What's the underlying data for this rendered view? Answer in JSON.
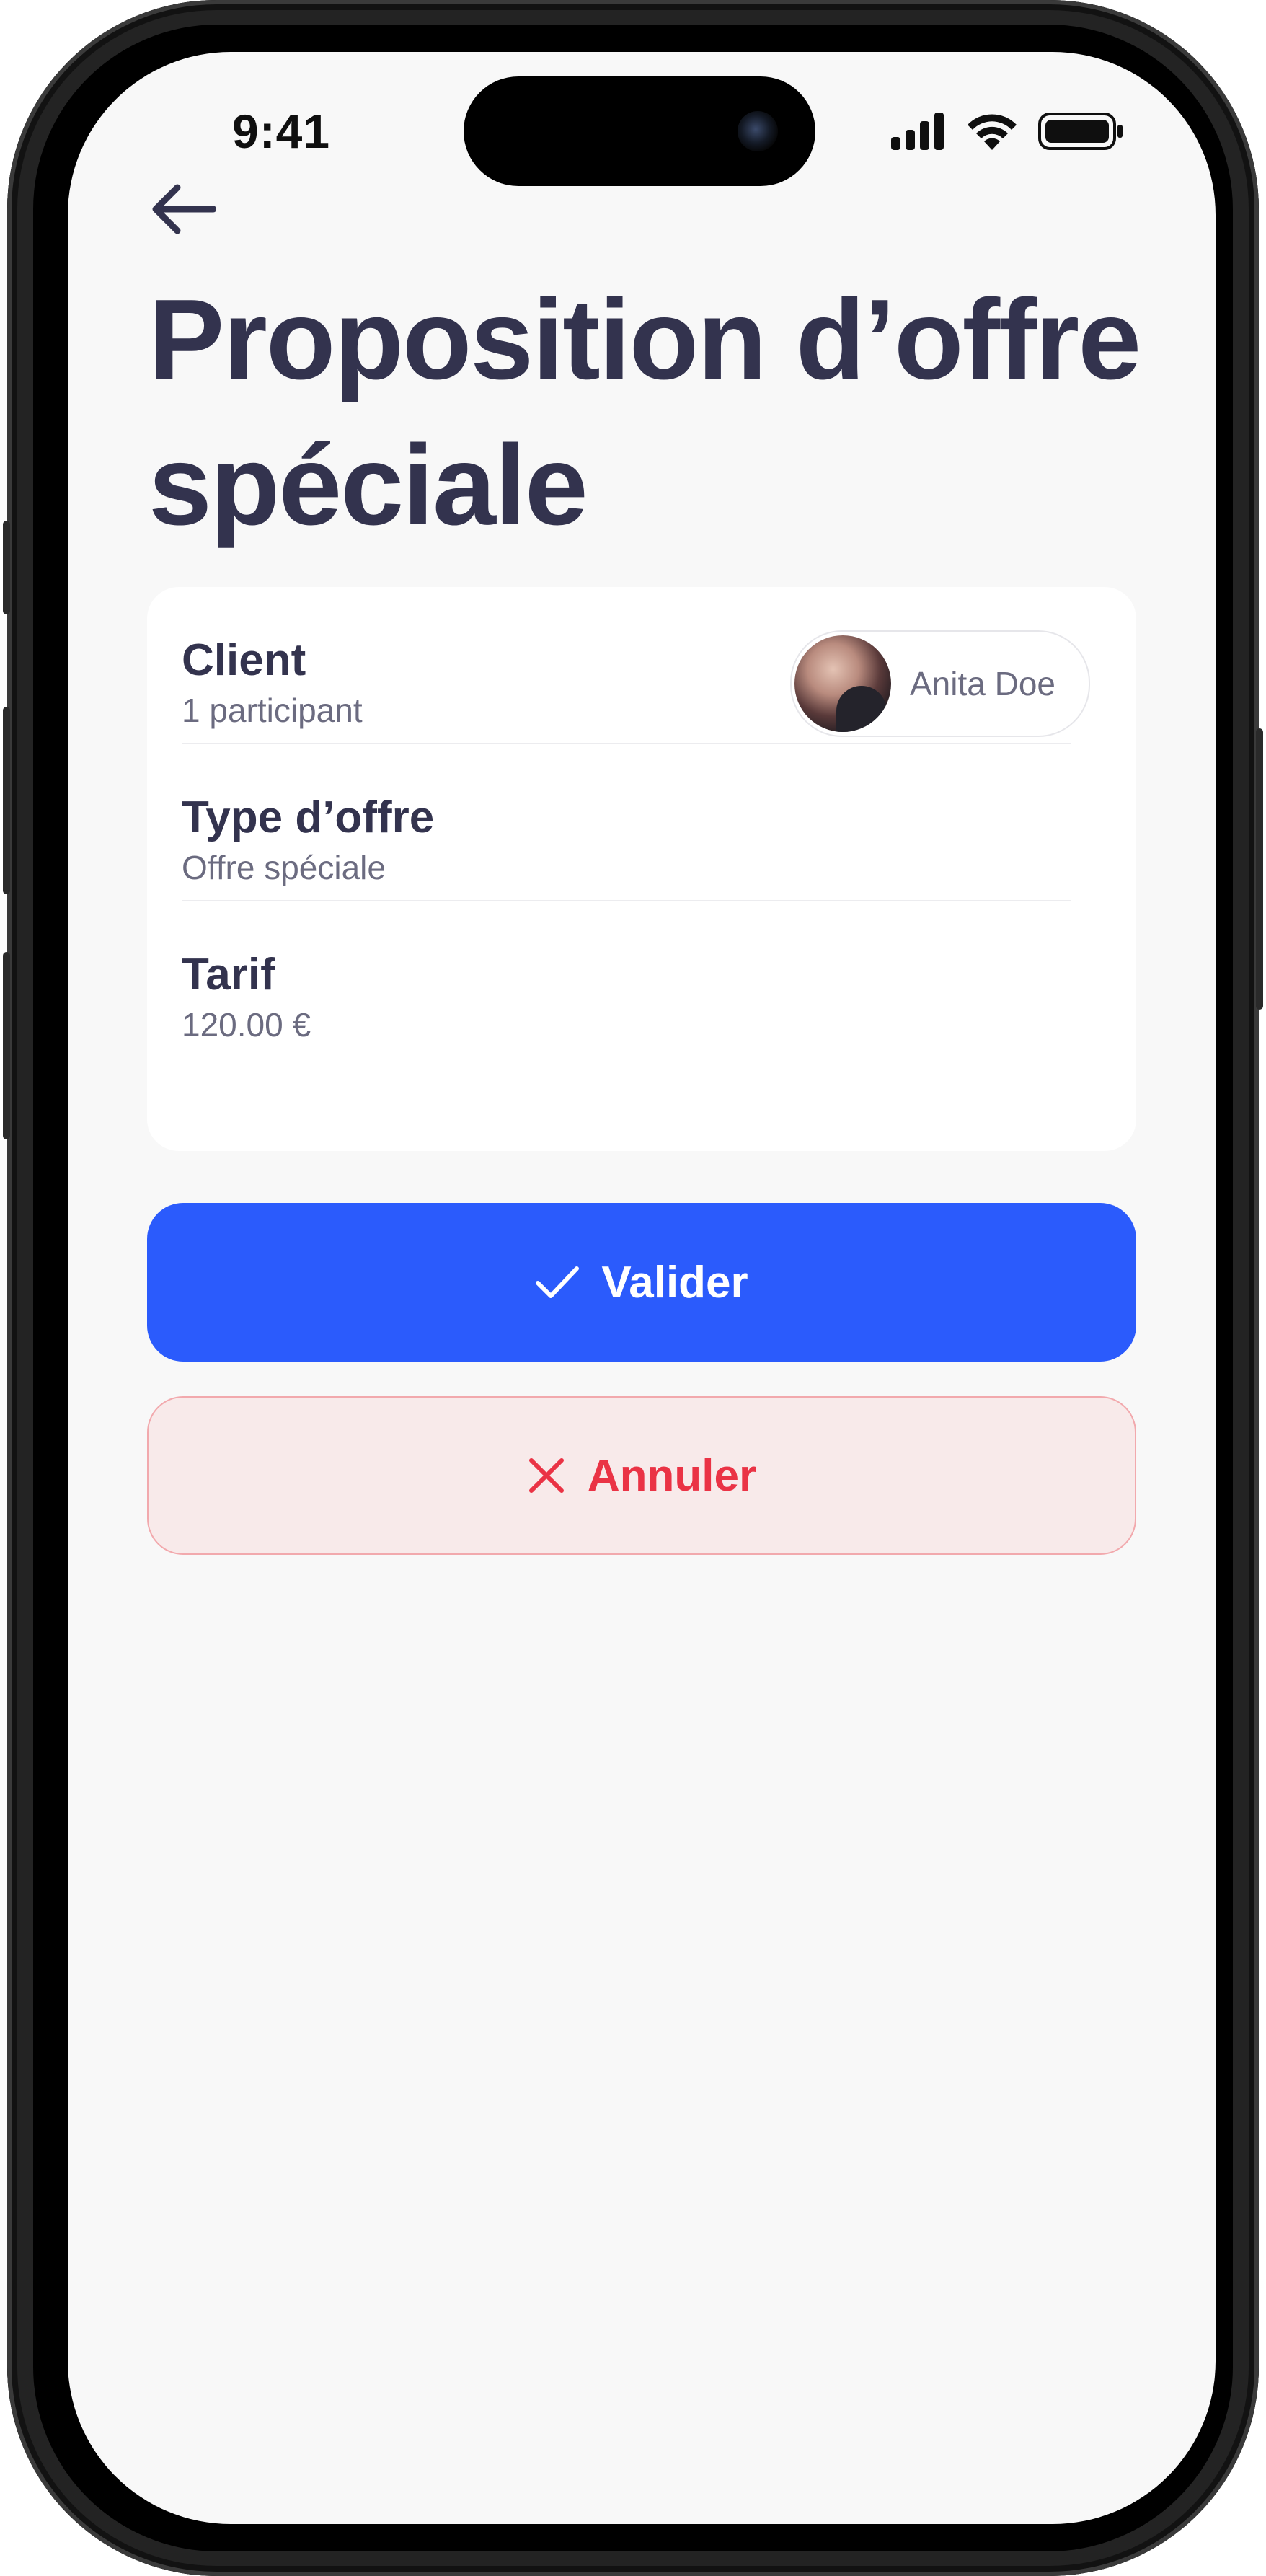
{
  "status_bar": {
    "time": "9:41"
  },
  "page": {
    "title": "Proposition d’offre spéciale"
  },
  "details": {
    "client": {
      "label": "Client",
      "value": "1 participant",
      "person_name": "Anita Doe"
    },
    "offer_type": {
      "label": "Type d’offre",
      "value": "Offre spéciale"
    },
    "rate": {
      "label": "Tarif",
      "value": "120.00 €"
    }
  },
  "actions": {
    "validate_label": "Valider",
    "cancel_label": "Annuler"
  },
  "colors": {
    "primary": "#2b5bfc",
    "danger": "#ea3345",
    "danger_bg": "#f8eaea",
    "heading": "#33334e",
    "muted": "#6b6b80",
    "background": "#f8f8f8"
  },
  "icons": [
    "back-arrow-icon",
    "signal-icon",
    "wifi-icon",
    "battery-icon",
    "check-icon",
    "close-icon"
  ]
}
